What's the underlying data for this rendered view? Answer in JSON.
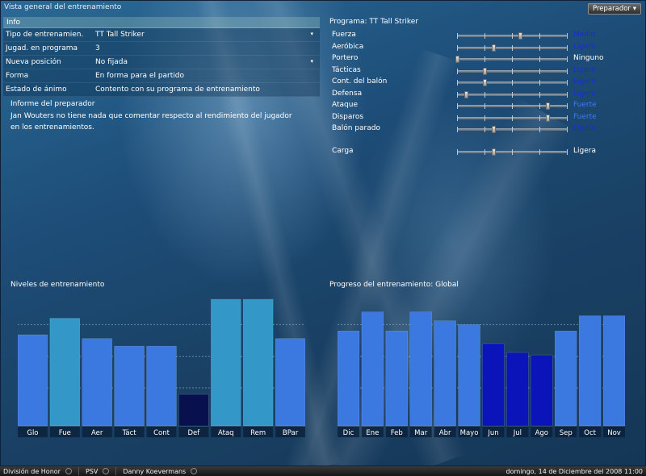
{
  "window": {
    "title": "Vista general del entrenamiento",
    "role_select": "Preparador"
  },
  "info": {
    "header": "Info",
    "rows": [
      {
        "label": "Tipo de entrenamien.",
        "value": "TT Tall Striker",
        "dropdown": true
      },
      {
        "label": "Jugad. en programa",
        "value": "3",
        "dropdown": false
      },
      {
        "label": "Nueva posición",
        "value": "No fijada",
        "dropdown": true
      },
      {
        "label": "Forma",
        "value": "En forma para el partido",
        "dropdown": false
      },
      {
        "label": "Estado de ánimo",
        "value": "Contento con su programa de entrenamiento",
        "dropdown": false
      }
    ]
  },
  "report": {
    "title": "Informe del preparador",
    "text": "Jan Wouters no tiene nada que comentar respecto al rendimiento del jugador en los entrenamientos."
  },
  "program": {
    "title": "Programa: TT Tall Striker",
    "colors": {
      "Medio": "#1a2fc8",
      "Ligero": "#1a2fc8",
      "Ninguno": "#ffffff",
      "Fuerte": "#3a7cf0",
      "Ligera": "#ffffff"
    },
    "sliders": [
      {
        "label": "Fuerza",
        "level": 0.57,
        "value": "Medio"
      },
      {
        "label": "Aeróbica",
        "level": 0.33,
        "value": "Ligero"
      },
      {
        "label": "Portero",
        "level": 0.0,
        "value": "Ninguno"
      },
      {
        "label": "Tácticas",
        "level": 0.25,
        "value": "Ligero"
      },
      {
        "label": "Cont. del balón",
        "level": 0.25,
        "value": "Ligero"
      },
      {
        "label": "Defensa",
        "level": 0.08,
        "value": "Ligero"
      },
      {
        "label": "Ataque",
        "level": 0.82,
        "value": "Fuerte"
      },
      {
        "label": "Disparos",
        "level": 0.82,
        "value": "Fuerte"
      },
      {
        "label": "Balón parado",
        "level": 0.33,
        "value": "Ligero"
      }
    ],
    "load": {
      "label": "Carga",
      "level": 0.33,
      "value": "Ligera"
    }
  },
  "chart_data": [
    {
      "type": "bar",
      "title": "Niveles de entrenamiento",
      "categories": [
        "Glo",
        "Fue",
        "Aer",
        "Táct",
        "Cont",
        "Def",
        "Ataq",
        "Rem",
        "BPar"
      ],
      "values": [
        72,
        85,
        69,
        63,
        63,
        25,
        100,
        100,
        69
      ],
      "colors": [
        "#3b78e0",
        "#3398c8",
        "#3b78e0",
        "#3b78e0",
        "#3b78e0",
        "#08104e",
        "#3398c8",
        "#3398c8",
        "#3b78e0"
      ],
      "ylim": [
        0,
        100
      ],
      "grid": true
    },
    {
      "type": "bar",
      "title": "Progreso del entrenamiento: Global",
      "categories": [
        "Dic",
        "Ene",
        "Feb",
        "Mar",
        "Abr",
        "Mayo",
        "Jun",
        "Jul",
        "Ago",
        "Sep",
        "Oct",
        "Nov"
      ],
      "values": [
        75,
        90,
        75,
        90,
        83,
        80,
        65,
        58,
        56,
        75,
        87,
        87
      ],
      "colors": [
        "#3b78e0",
        "#3b78e0",
        "#3b78e0",
        "#3b78e0",
        "#3b78e0",
        "#3b78e0",
        "#0a14b8",
        "#0a14b8",
        "#0a14b8",
        "#3b78e0",
        "#3b78e0",
        "#3b78e0"
      ],
      "ylim": [
        0,
        100
      ],
      "grid": true
    }
  ],
  "status_bar": {
    "division": "División de Honor",
    "club": "PSV",
    "manager": "Danny Koevermans",
    "datetime": "domingo, 14 de Diciembre del 2008 11:00"
  }
}
